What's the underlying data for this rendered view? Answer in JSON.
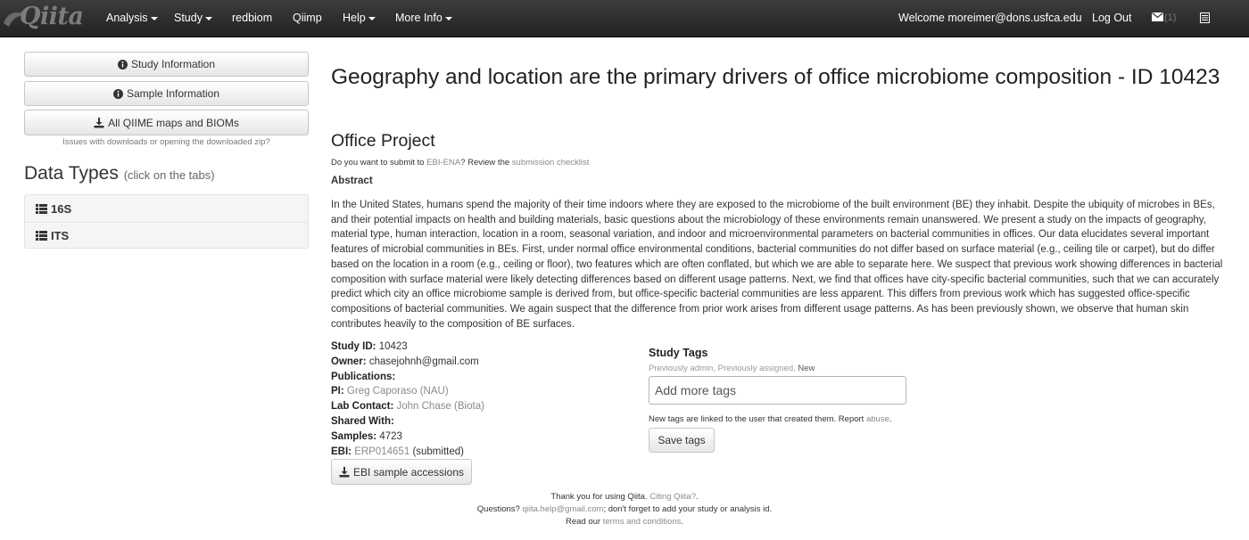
{
  "navbar": {
    "brand": "Qiita",
    "items": [
      {
        "label": "Analysis",
        "dropdown": true
      },
      {
        "label": "Study",
        "dropdown": true
      },
      {
        "label": "redbiom",
        "dropdown": false
      },
      {
        "label": "Qiimp",
        "dropdown": false
      },
      {
        "label": "Help",
        "dropdown": true
      },
      {
        "label": "More Info",
        "dropdown": true
      }
    ],
    "welcome": "Welcome moreimer@dons.usfca.edu",
    "logout": "Log Out",
    "message_count": "(1)",
    "icons": {
      "messages": "envelope-icon",
      "tasks": "list-icon"
    }
  },
  "sidebar": {
    "study_information": "Study Information",
    "sample_information": "Sample Information",
    "download_all": "All QIIME maps and BIOMs",
    "download_note": "Issues with downloads or opening the downloaded zip?",
    "data_types_title": "Data Types",
    "data_types_hint": "(click on the tabs)",
    "data_types": [
      "16S",
      "ITS"
    ]
  },
  "main": {
    "title": "Geography and location are the primary drivers of office microbiome composition - ID 10423",
    "subtitle": "Office Project",
    "ebi_prompt_1": "Do you want to submit to ",
    "ebi_link": "EBI-ENA",
    "ebi_prompt_2": "? Review the ",
    "checklist_link": "submission checklist",
    "abstract_label": "Abstract",
    "abstract": "In the United States, humans spend the majority of their time indoors where they are exposed to the microbiome of the built environment (BE) they inhabit. Despite the ubiquity of microbes in BEs, and their potential impacts on health and building materials, basic questions about the microbiology of these environments remain unanswered. We present a study on the impacts of geography, material type, human interaction, location in a room, seasonal variation, and indoor and microenvironmental parameters on bacterial communities in offices. Our data elucidates several important features of microbial communities in BEs. First, under normal office environmental conditions, bacterial communities do not differ based on surface material (e.g., ceiling tile or carpet), but do differ based on the location in a room (e.g., ceiling or floor), two features which are often conflated, but which we are able to separate here. We suspect that previous work showing differences in bacterial composition with surface material were likely detecting differences based on different usage patterns. Next, we find that offices have city-specific bacterial communities, such that we can accurately predict which city an office microbiome sample is derived from, but office-specific bacterial communities are less apparent. This differs from previous work which has suggested office-specific compositions of bacterial communities. We again suspect that the difference from prior work arises from different usage patterns. As has been previously shown, we observe that human skin contributes heavily to the composition of BE surfaces.",
    "details": {
      "study_id_label": "Study ID:",
      "study_id": "10423",
      "owner_label": "Owner:",
      "owner": "chasejohnh@gmail.com",
      "publications_label": "Publications:",
      "pi_label": "PI:",
      "pi": "Greg Caporaso (NAU)",
      "lab_contact_label": "Lab Contact:",
      "lab_contact": "John Chase (Biota)",
      "shared_with_label": "Shared With:",
      "samples_label": "Samples:",
      "samples": "4723",
      "ebi_label": "EBI:",
      "ebi_accession": "ERP014651",
      "ebi_status": "(submitted)"
    },
    "accessions_button": "EBI sample accessions",
    "tags": {
      "title": "Study Tags",
      "previously_admin": "Previously admin",
      "previously_assigned": "Previously assigned",
      "new": "New",
      "placeholder": "Add more tags",
      "note_prefix": "New tags are linked to the user that created them. Report ",
      "abuse_link": "abuse",
      "note_suffix": ".",
      "save_label": "Save tags"
    }
  },
  "footer": {
    "thanks": "Thank you for using Qiita. ",
    "citing_link": "Citing Qiita?",
    "citing_suffix": ".",
    "questions": "Questions? ",
    "help_email": "qiita.help@gmail.com",
    "questions_suffix": "; don't forget to add your study or analysis id.",
    "read_our": "Read our ",
    "terms_link": "terms and conditions",
    "terms_suffix": "."
  }
}
